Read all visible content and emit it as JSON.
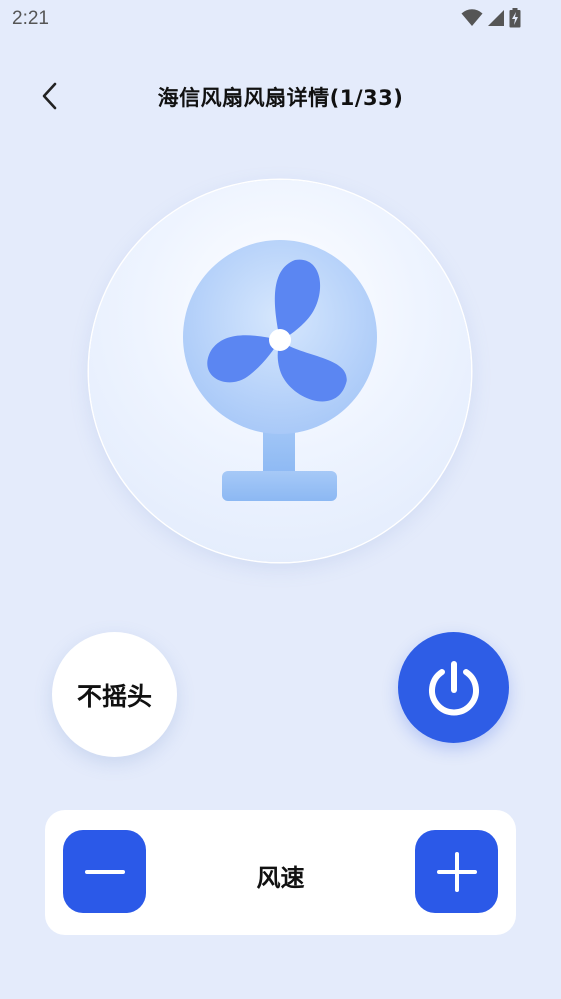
{
  "status_bar": {
    "time": "2:21",
    "icons": [
      "wifi-icon",
      "cellular-signal-icon",
      "battery-charging-icon"
    ]
  },
  "header": {
    "title": "海信风扇风扇详情(1/33)",
    "back_icon": "chevron-left-icon"
  },
  "fan_display": {
    "icon": "desk-fan-icon",
    "colors": {
      "blade": "#5b86f2",
      "head": "#bcd6fb",
      "stand": "#98c1f5"
    }
  },
  "controls": {
    "swing_label": "不摇头",
    "power_icon": "power-icon",
    "power_color": "#2e5de6"
  },
  "speed": {
    "label": "风速",
    "minus_icon": "minus-icon",
    "plus_icon": "plus-icon",
    "button_color": "#2b59e8"
  }
}
